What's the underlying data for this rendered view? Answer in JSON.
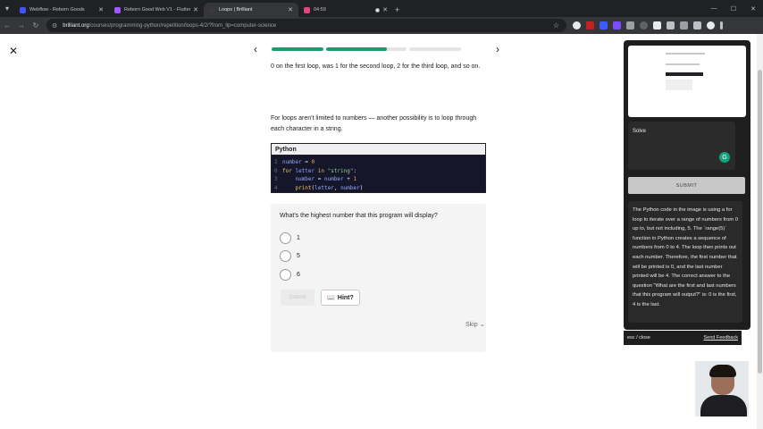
{
  "browser": {
    "tabs": [
      {
        "label": "Webflow - Reborn Goods",
        "favicon_color": "#4353ff",
        "active": false,
        "recording": false
      },
      {
        "label": "Reborn Good Web V1 - Flutter...",
        "favicon_color": "#a259ff",
        "active": false,
        "recording": false
      },
      {
        "label": "Loops | Brilliant",
        "favicon_color": "#3a3a3a",
        "active": true,
        "recording": false
      },
      {
        "label": "04:59",
        "favicon_color": "#e0457b",
        "active": false,
        "recording": true
      }
    ],
    "new_tab_symbol": "+",
    "url_host": "brilliant.org",
    "url_path": "/courses/programming-python/repetition/loops-4/2/?from_llp=computer-science"
  },
  "lesson": {
    "close_symbol": "✕",
    "progress": [
      1.0,
      0.75,
      0.0
    ],
    "prev_symbol": "‹",
    "next_symbol": "›",
    "paragraph_top": "0 on the first loop, was 1 for the second loop, 2 for the third loop, and so on.",
    "paragraph_main": "For loops aren't limited to numbers — another possibility is to loop through each character in a string.",
    "code": {
      "language": "Python",
      "lines": [
        {
          "n": "1",
          "parts": [
            [
              "var",
              "number"
            ],
            [
              "op",
              " = "
            ],
            [
              "num",
              "0"
            ]
          ]
        },
        {
          "n": "0",
          "parts": [
            [
              "kw",
              "for "
            ],
            [
              "var",
              "letter"
            ],
            [
              "kw",
              " in "
            ],
            [
              "str",
              "\"string\""
            ],
            [
              "op",
              ":"
            ]
          ]
        },
        {
          "n": "3",
          "parts": [
            [
              "op",
              "    "
            ],
            [
              "var",
              "number"
            ],
            [
              "op",
              " = "
            ],
            [
              "var",
              "number"
            ],
            [
              "op",
              " + "
            ],
            [
              "num",
              "1"
            ]
          ]
        },
        {
          "n": "4",
          "parts": [
            [
              "op",
              "    "
            ],
            [
              "fn",
              "print"
            ],
            [
              "op",
              "("
            ],
            [
              "var",
              "letter"
            ],
            [
              "op",
              ", "
            ],
            [
              "var",
              "number"
            ],
            [
              "op",
              ")"
            ]
          ]
        }
      ]
    },
    "question": "What's the highest number that this program will display?",
    "options": [
      "1",
      "5",
      "6"
    ],
    "submit_label": "Submit",
    "hint_label": "Hint?",
    "skip_label": "Skip"
  },
  "assistant": {
    "solve_label": "Solve",
    "submit_label": "SUBMIT",
    "answer": "The Python code in the image is using a for loop to iterate over a range of numbers from 0 up to, but not including, 5. The `range(5)` function in Python creates a sequence of numbers from 0 to 4. The loop then prints out each number. Therefore, the first number that will be printed is 0, and the last number printed will be 4. The correct answer to the question \"What are the first and last numbers that this program will output?\" is: 0 is the first, 4 is the last.",
    "esc_label": "esc / close",
    "feedback_label": "Send Feedback"
  },
  "colors": {
    "progress_fill": "#1f9c6d",
    "code_bg": "#15162a"
  }
}
